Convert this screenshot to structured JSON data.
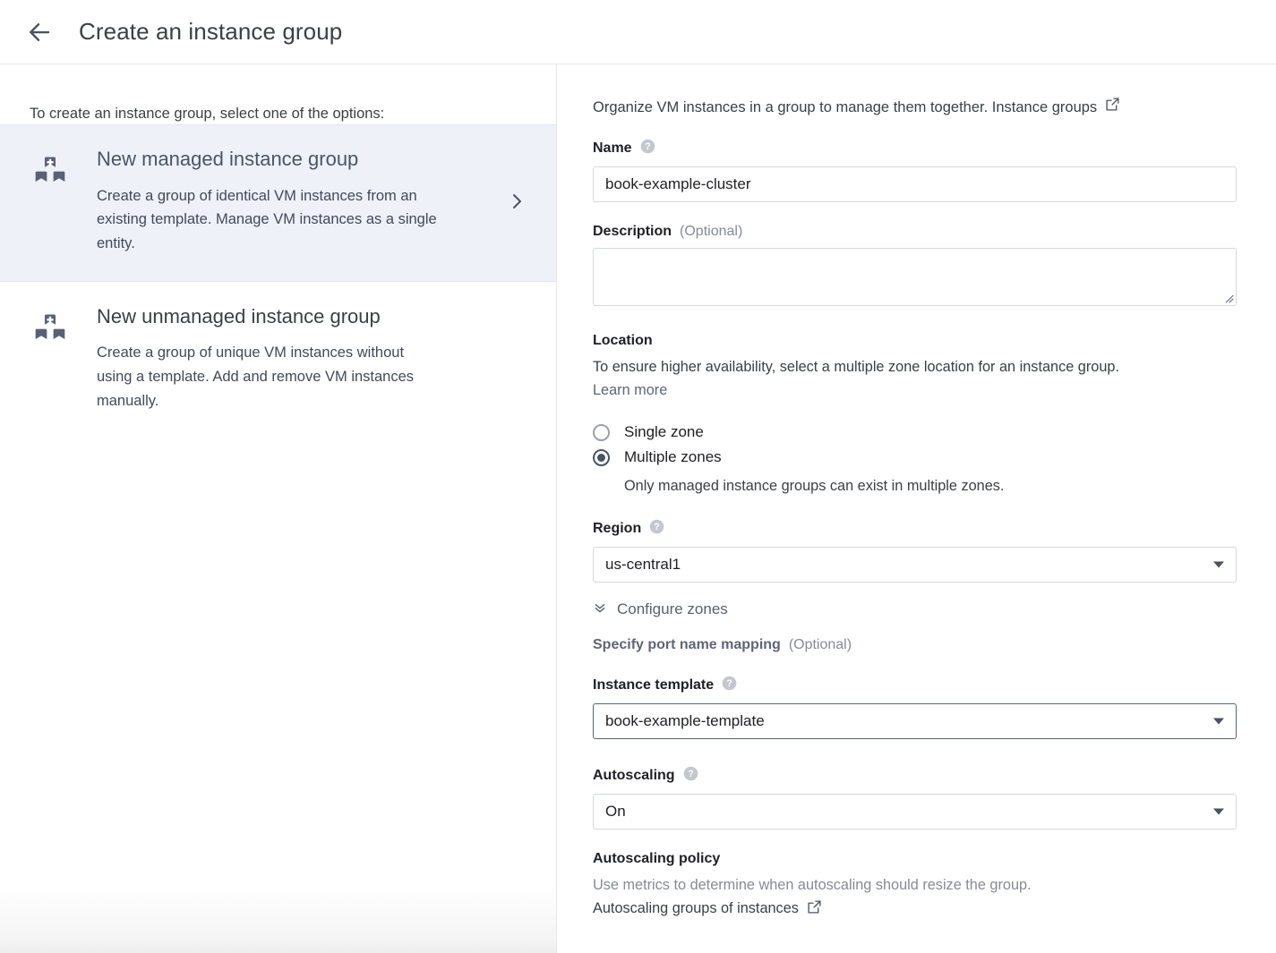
{
  "header": {
    "back_icon": "arrow-left-icon",
    "title": "Create an instance group"
  },
  "left_panel": {
    "intro": "To create an instance group, select one of the options:",
    "options": [
      {
        "icon": "instance-group-icon",
        "title": "New managed instance group",
        "description": "Create a group of identical VM instances from an existing template. Manage VM instances as a single entity.",
        "selected": true,
        "chevron": "chevron-right-icon"
      },
      {
        "icon": "instance-group-icon",
        "title": "New unmanaged instance group",
        "description": "Create a group of unique VM instances without using a template. Add and remove VM instances manually.",
        "selected": false
      }
    ]
  },
  "right_panel": {
    "intro_text": "Organize VM instances in a group to manage them together. Instance groups",
    "intro_link_icon": "external-link-icon",
    "name": {
      "label": "Name",
      "help_icon": "help-circle-icon",
      "value": "book-example-cluster",
      "placeholder": ""
    },
    "description": {
      "label": "Description",
      "optional": "(Optional)",
      "value": "",
      "placeholder": "",
      "resize_icon": "resize-handle-icon"
    },
    "location": {
      "title": "Location",
      "description": "To ensure higher availability, select a multiple zone location for an instance group.",
      "learn_more": "Learn more",
      "radios": [
        {
          "label": "Single zone",
          "checked": false
        },
        {
          "label": "Multiple zones",
          "checked": true
        }
      ],
      "multiple_zones_note": "Only managed instance groups can exist in multiple zones."
    },
    "region": {
      "label": "Region",
      "help_icon": "help-circle-icon",
      "value": "us-central1",
      "arrow_icon": "chevron-down-icon"
    },
    "configure_zones": {
      "label": "Configure zones",
      "icon": "double-chevron-down-icon"
    },
    "port_mapping": {
      "label": "Specify port name mapping",
      "optional": "(Optional)"
    },
    "instance_template": {
      "label": "Instance template",
      "help_icon": "help-circle-icon",
      "value": "book-example-template",
      "arrow_icon": "chevron-down-icon",
      "focused": true
    },
    "autoscaling": {
      "label": "Autoscaling",
      "help_icon": "help-circle-icon",
      "value": "On",
      "arrow_icon": "chevron-down-icon"
    },
    "autoscaling_policy": {
      "title": "Autoscaling policy",
      "description": "Use metrics to determine when autoscaling should resize the group.",
      "link": "Autoscaling groups of instances",
      "link_icon": "external-link-icon"
    }
  },
  "colors": {
    "selected_card_bg": "#eef1f8",
    "text_primary": "#202124",
    "text_secondary": "#3c4043",
    "text_muted": "#868b95",
    "border": "#d5d8de",
    "icon": "#4a5263"
  }
}
